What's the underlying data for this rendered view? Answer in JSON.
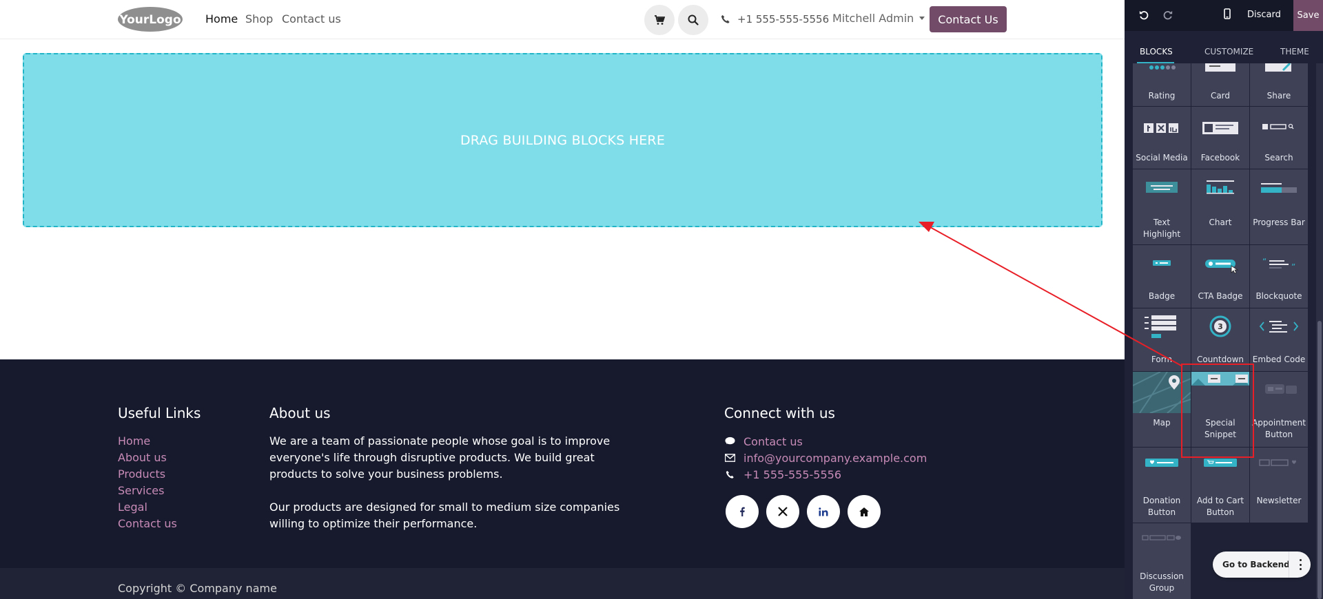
{
  "header": {
    "logo_text": "YourLogo",
    "nav": [
      "Home",
      "Shop",
      "Contact us"
    ],
    "phone": "+1 555-555-5556",
    "user": "Mitchell Admin",
    "cta_label": "Contact Us"
  },
  "canvas": {
    "dropzone_text": "DRAG BUILDING BLOCKS HERE"
  },
  "footer": {
    "useful_links_title": "Useful Links",
    "useful_links": [
      "Home",
      "About us",
      "Products",
      "Services",
      "Legal",
      "Contact us"
    ],
    "about_title": "About us",
    "about_p1": "We are a team of passionate people whose goal is to improve everyone's life through disruptive products. We build great products to solve your business problems.",
    "about_p2": "Our products are designed for small to medium size companies willing to optimize their performance.",
    "connect_title": "Connect with us",
    "contact_link": "Contact us",
    "email": "info@yourcompany.example.com",
    "phone": "+1 555-555-5556",
    "copyright": "Copyright © Company name"
  },
  "editor": {
    "discard": "Discard",
    "save": "Save",
    "tabs": [
      "BLOCKS",
      "CUSTOMIZE",
      "THEME"
    ],
    "blocks": [
      {
        "label": "Rating",
        "icon": "rating-icon"
      },
      {
        "label": "Card",
        "icon": "card-icon"
      },
      {
        "label": "Share",
        "icon": "share-icon"
      },
      {
        "label": "Social Media",
        "icon": "social-media-icon"
      },
      {
        "label": "Facebook",
        "icon": "facebook-icon"
      },
      {
        "label": "Search",
        "icon": "search-snippet-icon"
      },
      {
        "label": "Text Highlight",
        "icon": "text-highlight-icon"
      },
      {
        "label": "Chart",
        "icon": "chart-icon"
      },
      {
        "label": "Progress Bar",
        "icon": "progress-bar-icon"
      },
      {
        "label": "Badge",
        "icon": "badge-icon"
      },
      {
        "label": "CTA Badge",
        "icon": "cta-badge-icon"
      },
      {
        "label": "Blockquote",
        "icon": "blockquote-icon"
      },
      {
        "label": "Form",
        "icon": "form-icon"
      },
      {
        "label": "Countdown",
        "icon": "countdown-icon",
        "countdown_digit": "3"
      },
      {
        "label": "Embed Code",
        "icon": "embed-code-icon"
      },
      {
        "label": "Map",
        "icon": "map-icon"
      },
      {
        "label": "Special Snippet",
        "icon": "special-snippet-icon"
      },
      {
        "label": "Appointment Button",
        "icon": "appointment-icon"
      },
      {
        "label": "Donation Button",
        "icon": "donation-icon"
      },
      {
        "label": "Add to Cart Button",
        "icon": "add-to-cart-icon"
      },
      {
        "label": "Newsletter",
        "icon": "newsletter-icon"
      },
      {
        "label": "Discussion Group",
        "icon": "discussion-group-icon"
      }
    ],
    "go_to_backend": "Go to Backend"
  },
  "colors": {
    "brand": "#714b67",
    "dropzone": "#7fdde9",
    "footer_bg": "#161a2c",
    "footer_link": "#c88bb8",
    "panel_bg": "#1f2236",
    "accent_teal": "#34b3c7",
    "highlight_red": "#e81f27"
  }
}
